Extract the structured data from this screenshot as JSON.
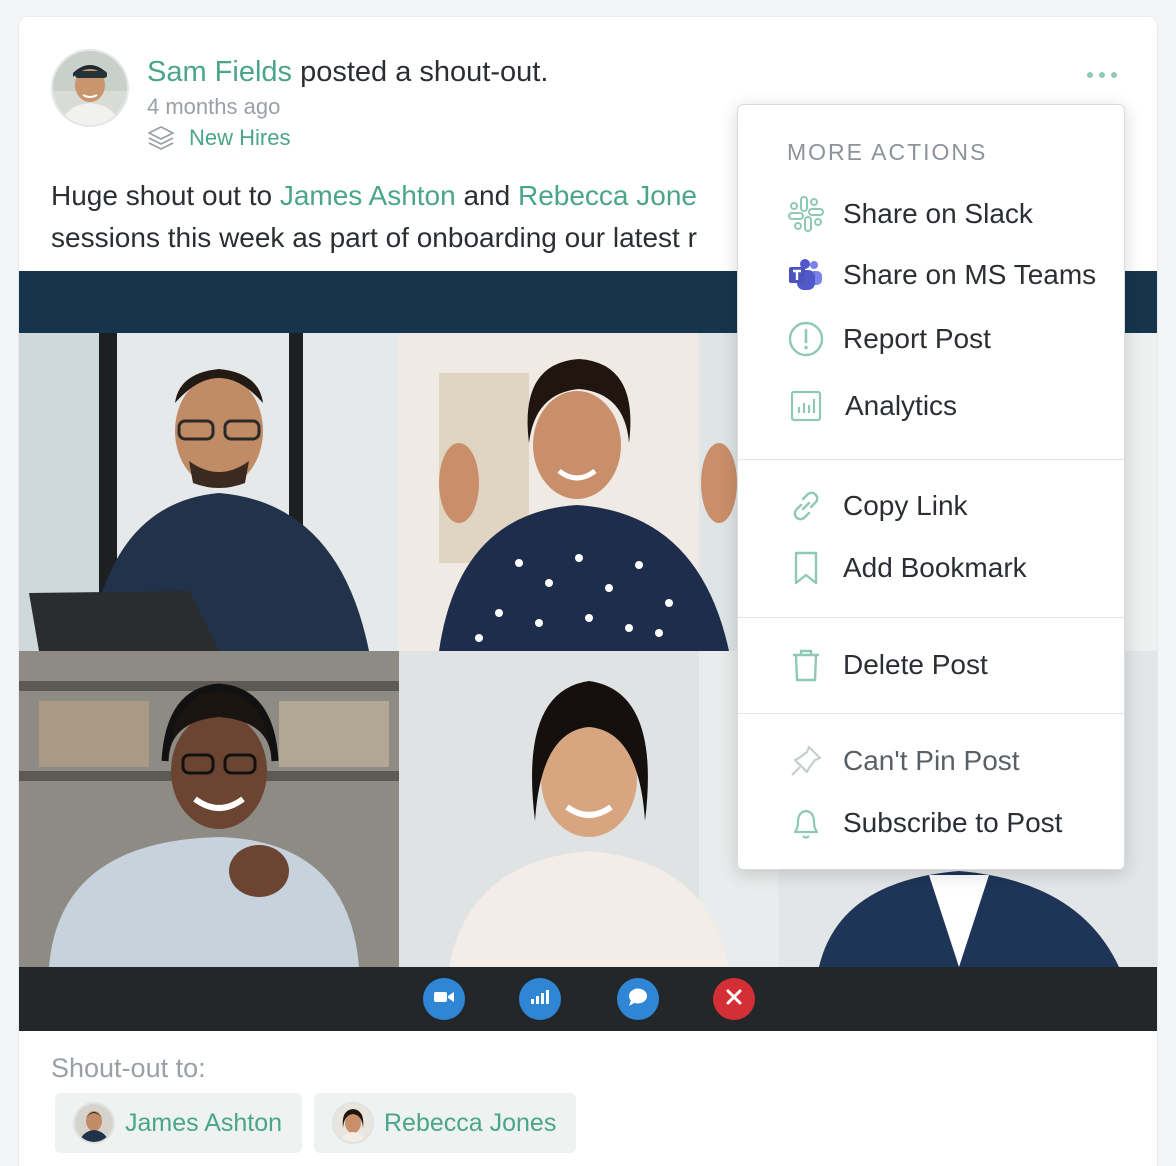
{
  "post": {
    "author": "Sam Fields",
    "action": " posted a shout-out.",
    "time": "4 months ago",
    "group": "New Hires",
    "body": {
      "line1_prefix": "Huge shout out to ",
      "mention1": "James Ashton",
      "and": " and ",
      "mention2": "Rebecca Jone",
      "line2": "sessions this week as part of onboarding our latest r"
    }
  },
  "menu": {
    "title": "MORE ACTIONS",
    "items": [
      {
        "label": "Share on Slack",
        "icon": "slack-icon"
      },
      {
        "label": "Share on MS Teams",
        "icon": "ms-teams-icon"
      },
      {
        "label": "Report Post",
        "icon": "alert-circle-icon"
      },
      {
        "label": "Analytics",
        "icon": "bar-chart-icon"
      },
      {
        "label": "Copy Link",
        "icon": "link-icon"
      },
      {
        "label": "Add Bookmark",
        "icon": "bookmark-icon"
      },
      {
        "label": "Delete Post",
        "icon": "trash-icon"
      },
      {
        "label": "Can't Pin Post",
        "icon": "pin-icon"
      },
      {
        "label": "Subscribe to Post",
        "icon": "bell-icon"
      }
    ]
  },
  "shoutout": {
    "label": "Shout-out to:",
    "recipients": [
      "James Ashton",
      "Rebecca Jones"
    ]
  },
  "colors": {
    "accent": "#4aa58a",
    "muted_text": "#9aa0a6",
    "video_band": "#16354d",
    "control_bar": "#24272a",
    "control_blue": "#2f86d4",
    "control_red": "#d42f34"
  },
  "video_controls": [
    "video-camera-icon",
    "signal-bars-icon",
    "chat-bubble-icon",
    "close-icon"
  ]
}
